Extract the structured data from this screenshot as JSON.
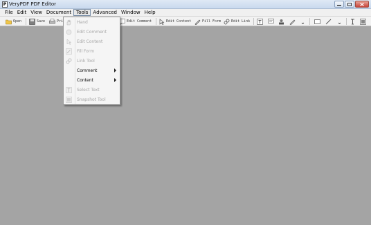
{
  "window": {
    "title": "VeryPDF PDF Editor",
    "icon_letter": "P"
  },
  "menubar": {
    "items": [
      {
        "label": "File",
        "active": false
      },
      {
        "label": "Edit",
        "active": false
      },
      {
        "label": "View",
        "active": false
      },
      {
        "label": "Document",
        "active": false
      },
      {
        "label": "Tools",
        "active": true
      },
      {
        "label": "Advanced",
        "active": false
      },
      {
        "label": "Window",
        "active": false
      },
      {
        "label": "Help",
        "active": false
      }
    ]
  },
  "toolbar": {
    "open_label": "Open",
    "save_label": "Save",
    "print_label": "Pri",
    "edit_comment_label": "Edit Comment",
    "edit_content_label": "Edit Content",
    "fill_form_label": "Fill Form",
    "edit_link_label": "Edit Link"
  },
  "tools_menu": {
    "items": [
      {
        "label": "Hand",
        "enabled": false,
        "icon": "hand-icon",
        "submenu": false
      },
      {
        "label": "Edit Comment",
        "enabled": false,
        "icon": "edit-comment-icon",
        "submenu": false
      },
      {
        "label": "Edit Content",
        "enabled": false,
        "icon": "edit-content-icon",
        "submenu": false
      },
      {
        "label": "Fill Form",
        "enabled": false,
        "icon": "fill-form-icon",
        "submenu": false
      },
      {
        "label": "Link Tool",
        "enabled": false,
        "icon": "link-icon",
        "submenu": false
      },
      {
        "label": "Comment",
        "enabled": true,
        "icon": "",
        "submenu": true
      },
      {
        "label": "Content",
        "enabled": true,
        "icon": "",
        "submenu": true
      },
      {
        "label": "Select Text",
        "enabled": false,
        "icon": "select-text-icon",
        "submenu": false
      },
      {
        "label": "Snapshot Tool",
        "enabled": false,
        "icon": "snapshot-icon",
        "submenu": false
      }
    ]
  },
  "colors": {
    "workspace": "#a4a4a4",
    "menu_bg": "#f5f5f5",
    "disabled_text": "#a6a6a6"
  }
}
